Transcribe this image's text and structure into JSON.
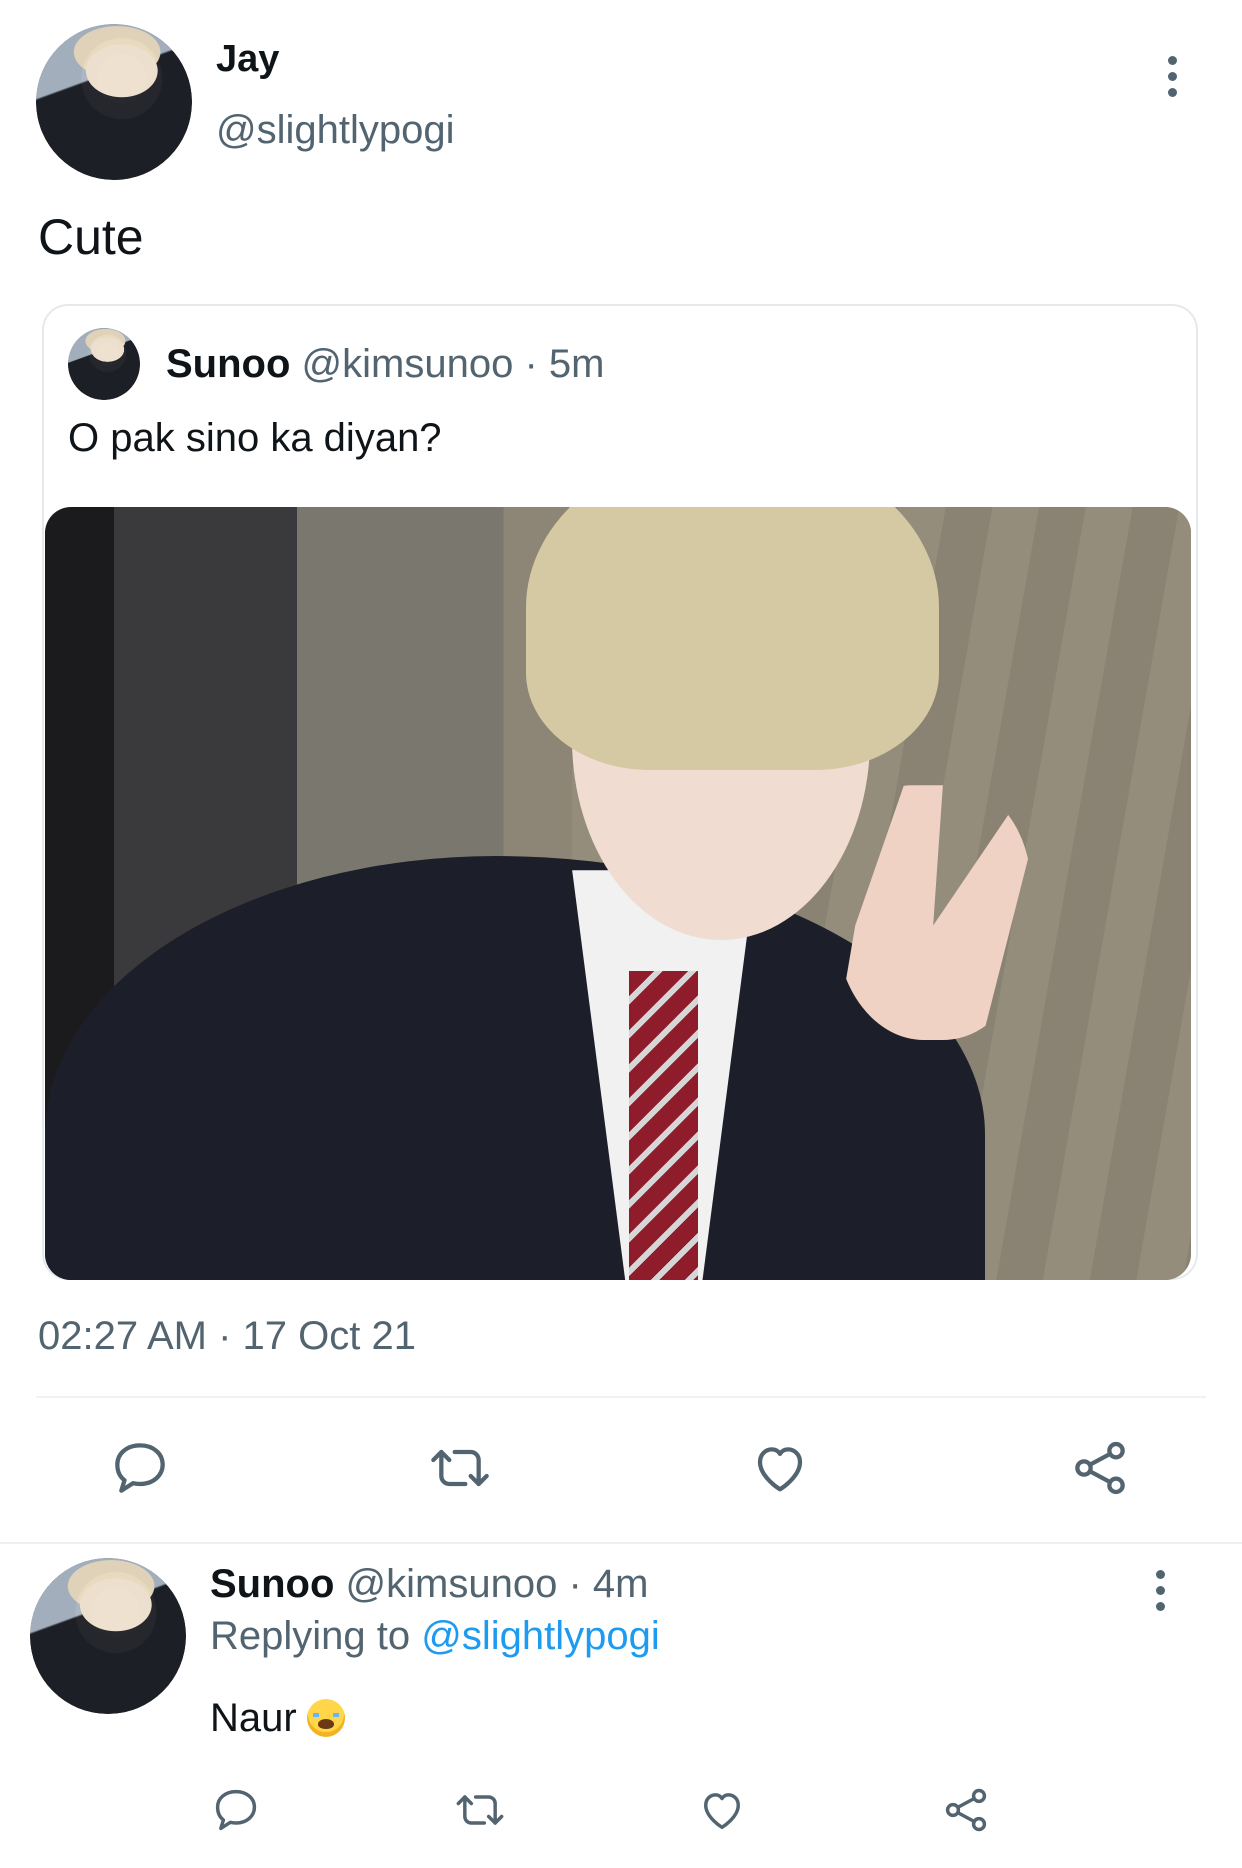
{
  "main_tweet": {
    "display_name": "Jay",
    "handle": "@slightlypogi",
    "text": "Cute",
    "timestamp": "02:27 AM · 17 Oct 21",
    "more_icon": "more-vertical-icon"
  },
  "quoted_tweet": {
    "display_name": "Sunoo",
    "handle": "@kimsunoo",
    "time": "· 5m",
    "text": "O pak sino ka diyan?"
  },
  "actions": {
    "reply_icon": "reply-icon",
    "retweet_icon": "retweet-icon",
    "like_icon": "like-icon",
    "share_icon": "share-icon"
  },
  "reply": {
    "display_name": "Sunoo",
    "handle": "@kimsunoo",
    "time": "· 4m",
    "replying_prefix": "Replying to",
    "replying_to": "@slightlypogi",
    "text": "Naur",
    "emoji": "loudly-crying-face-emoji"
  },
  "colors": {
    "text": "#0f1419",
    "muted": "#536471",
    "link": "#1d9bf0",
    "divider": "#eff3f4"
  }
}
